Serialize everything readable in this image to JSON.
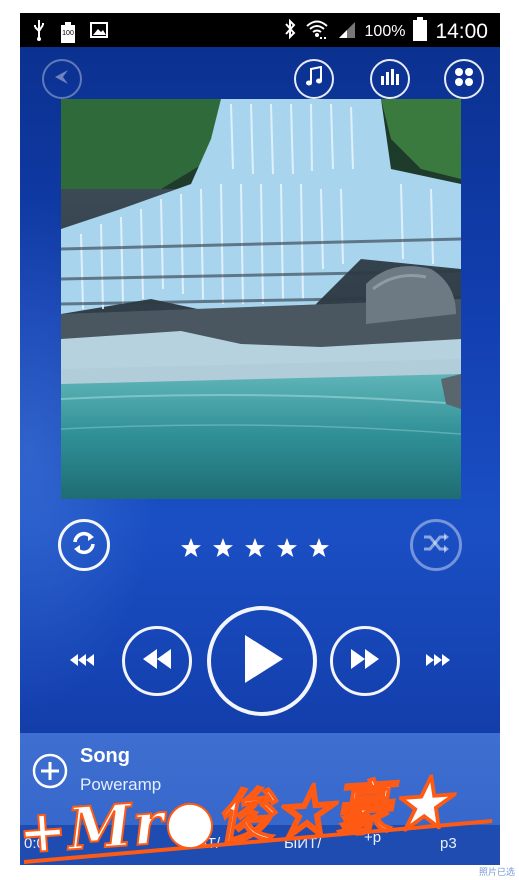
{
  "status_bar": {
    "battery_small_label": "100",
    "battery_percent": "100%",
    "time": "14:00",
    "icons": [
      "usb-icon",
      "battery-icon",
      "image-icon",
      "bluetooth-icon",
      "wifi-icon",
      "signal-icon",
      "battery-icon"
    ]
  },
  "top_bar": {
    "icons": [
      "back-arrow-icon",
      "music-note-icon",
      "equalizer-icon",
      "grid-icon"
    ]
  },
  "player": {
    "rating_stars": 5,
    "song_title": "Song",
    "artist": "Poweramp",
    "info_row": "0:0",
    "info_fragments": [
      "AT/",
      "ЫИТ/",
      "+р",
      "p3"
    ]
  },
  "watermark": {
    "text": "+Mr●俊☆豪★",
    "corner": "照片已选"
  },
  "colors": {
    "background": "#1440ae",
    "accent_white": "#ffffff",
    "watermark_orange": "#ff5a14"
  }
}
